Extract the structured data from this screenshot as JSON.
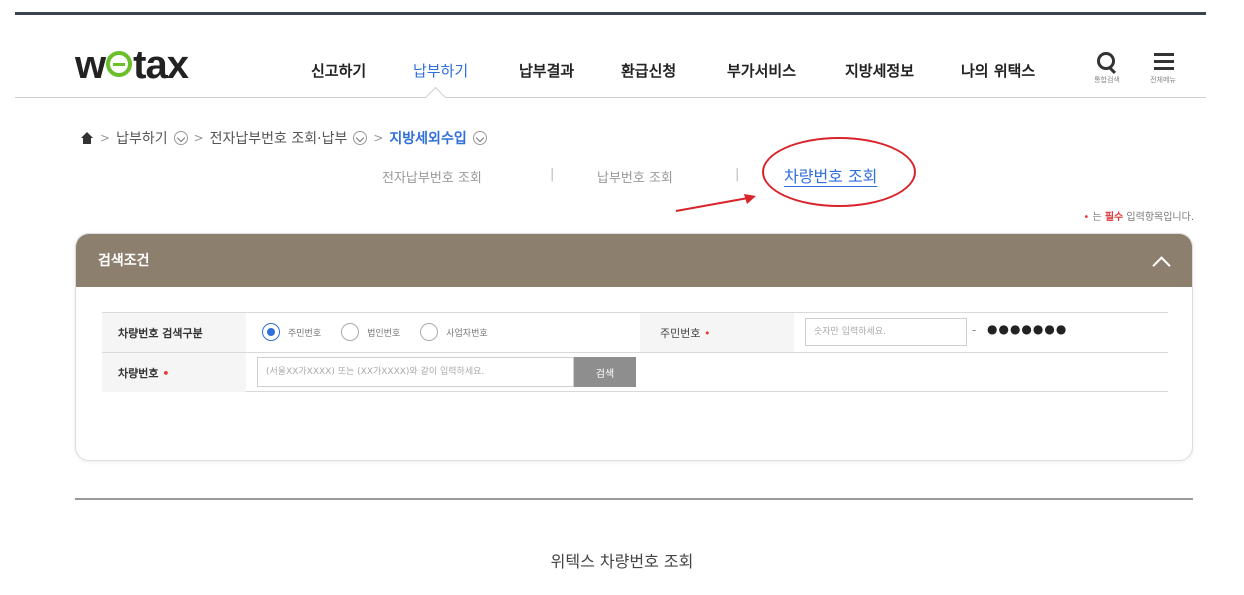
{
  "header": {
    "logo_text_1": "w",
    "logo_text_2": "tax",
    "nav": [
      "신고하기",
      "납부하기",
      "납부결과",
      "환급신청",
      "부가서비스",
      "지방세정보",
      "나의 위택스"
    ],
    "active_nav_index": 1,
    "search_caption": "통합검색",
    "menu_caption": "전체메뉴"
  },
  "breadcrumb": {
    "items": [
      "납부하기",
      "전자납부번호 조회·납부",
      "지방세외수입"
    ],
    "separator": ">"
  },
  "subtabs": {
    "items": [
      "전자납부번호 조회",
      "납부번호 조회",
      "차량번호 조회"
    ],
    "separator": "|",
    "active_index": 2
  },
  "required_note": {
    "dot": "•",
    "prefix": "는 ",
    "strong": "필수",
    "suffix": " 입력항목입니다."
  },
  "panel": {
    "title": "검색조건",
    "row1": {
      "label": "차량번호 검색구분",
      "options": [
        "주민번호",
        "법인번호",
        "사업자번호"
      ],
      "selected_index": 0,
      "field_label": "주민번호",
      "ssn_placeholder": "숫자만 입력하세요.",
      "ssn_separator": "-",
      "ssn_mask": "●●●●●●●"
    },
    "row2": {
      "label": "차량번호",
      "placeholder": "(서울XX가XXXX) 또는 (XX가XXXX)와 같이 입력하세요.",
      "button": "검색"
    },
    "required_mark": "•"
  },
  "caption": "위텍스 차량번호 조회",
  "colors": {
    "accent": "#2f6fdc",
    "panel_header": "#8c7f6e",
    "annotation": "#d8242a",
    "required": "#e23b3b",
    "logo_green": "#6bbf2a"
  }
}
